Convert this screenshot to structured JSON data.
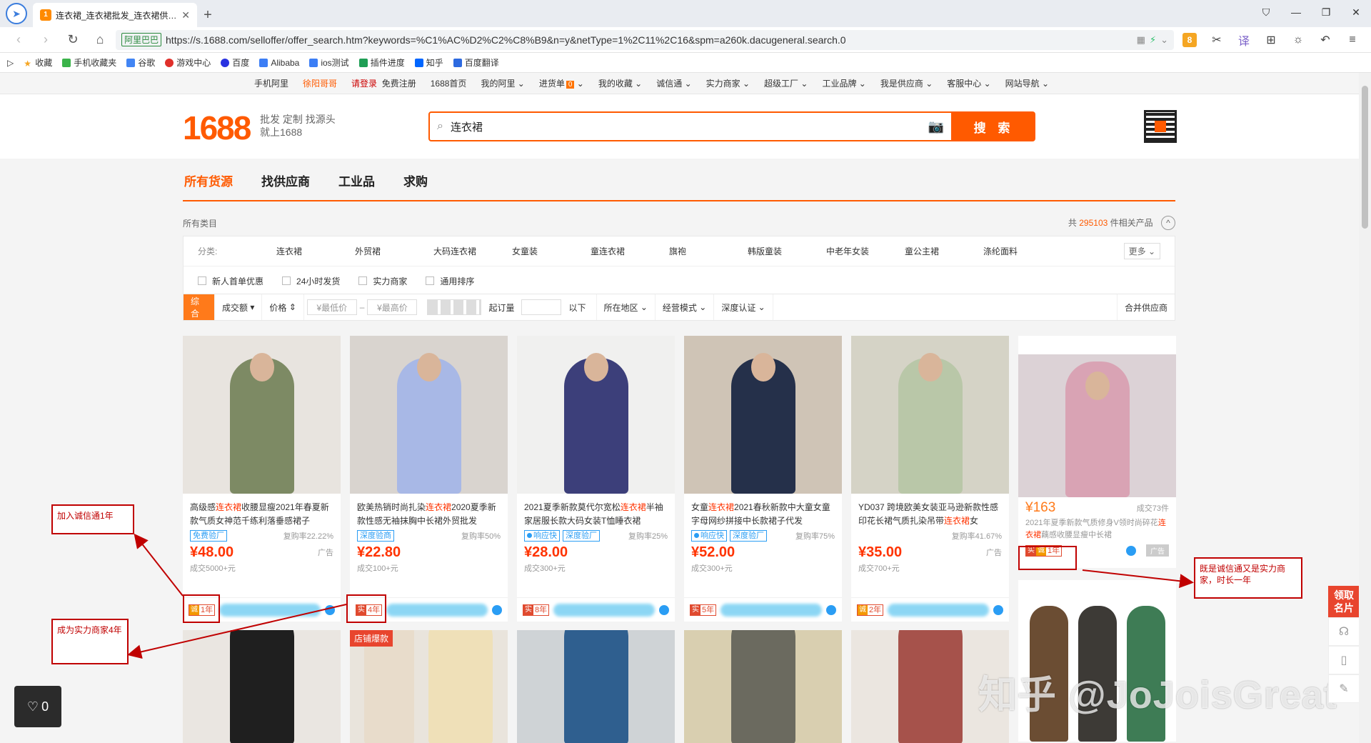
{
  "browser": {
    "tab_title": "连衣裙_连衣裙批发_连衣裙供应...",
    "url": "https://s.1688.com/selloffer/offer_search.htm?keywords=%C1%AC%D2%C2%C8%B9&n=y&netType=1%2C11%2C16&spm=a260k.dacugeneral.search.0",
    "site_label": "阿里巴巴",
    "bookmarks": [
      "收藏",
      "手机收藏夹",
      "谷歌",
      "游戏中心",
      "百度",
      "Alibaba",
      "ios测试",
      "插件进度",
      "知乎",
      "百度翻译"
    ]
  },
  "topnav": {
    "mobile": "手机阿里",
    "user": "徐阳哥哥",
    "login": "请登录",
    "register": "免费注册",
    "items": [
      "1688首页",
      "我的阿里",
      "进货单",
      "我的收藏",
      "诚信通",
      "实力商家",
      "超级工厂",
      "工业品牌",
      "我是供应商",
      "客服中心",
      "网站导航"
    ],
    "cart_count": "0"
  },
  "header": {
    "logo": "1688",
    "slogan_1": "批发 定制 找源头",
    "slogan_2": "就上1688",
    "search_value": "连衣裙",
    "search_button": "搜 索"
  },
  "main_tabs": [
    "所有货源",
    "找供应商",
    "工业品",
    "求购"
  ],
  "crumb": {
    "all_categories": "所有类目",
    "total_prefix": "共",
    "total_count": "295103",
    "total_suffix": "件相关产品"
  },
  "categories": {
    "label": "分类:",
    "items": [
      "连衣裙",
      "外贸裙",
      "大码连衣裙",
      "女童装",
      "童连衣裙",
      "旗袍",
      "韩版童装",
      "中老年女装",
      "童公主裙",
      "涤纶面料"
    ],
    "more": "更多"
  },
  "checkboxes": [
    "新人首单优惠",
    "24小时发货",
    "实力商家",
    "通用排序"
  ],
  "sortbar": {
    "items": [
      "综合",
      "成交额",
      "价格"
    ],
    "min_price": "¥最低价",
    "max_price": "¥最高价",
    "moq_label": "起订量",
    "below": "以下",
    "region": "所在地区",
    "mode": "经营模式",
    "cert": "深度认证",
    "merge": "合并供应商"
  },
  "products": [
    {
      "title_pre": "高级感",
      "kw": "连衣裙",
      "title_post": "收腰显瘦2021年春夏新款气质女神范千练利落垂感裙子",
      "tags": [
        "免费验厂"
      ],
      "rate": "复购率22.22%",
      "price": "¥48.00",
      "ad": "广告",
      "deal": "成交5000+元",
      "years": "1年",
      "img_bg": "#e8e4df",
      "fig": "#7d8a64"
    },
    {
      "title_pre": "欧美热销时尚扎染",
      "kw": "连衣裙",
      "title_post": "2020夏季新款性感无袖抹胸中长裙外贸批发",
      "tags": [
        "深度验商"
      ],
      "rate": "复购率50%",
      "price": "¥22.80",
      "ad": "",
      "deal": "成交100+元",
      "years": "4年",
      "img_bg": "#d9d4cf",
      "fig": "#a8b8e6"
    },
    {
      "title_pre": "2021夏季新款莫代尔宽松",
      "kw": "连衣裙",
      "title_post": "半袖家居服长款大码女装T恤睡衣裙",
      "tags": [
        "响应快",
        "深度验厂"
      ],
      "rate": "复购率25%",
      "price": "¥28.00",
      "ad": "",
      "deal": "成交300+元",
      "years": "8年",
      "img_bg": "#f0f0ef",
      "fig": "#3c3f7a"
    },
    {
      "title_pre": "女童",
      "kw": "连衣裙",
      "title_post": "2021春秋新款中大童女童字母网纱拼接中长款裙子代发",
      "tags": [
        "响应快",
        "深度验厂"
      ],
      "rate": "复购率75%",
      "price": "¥52.00",
      "ad": "",
      "deal": "成交300+元",
      "years": "5年",
      "img_bg": "#cfc4b6",
      "fig": "#25304a"
    },
    {
      "title_pre": "YD037 跨境欧美女装亚马逊新款性感印花长裙气质扎染吊带",
      "kw": "连衣裙",
      "title_post": "女",
      "tags": [],
      "rate": "复购率41.67%",
      "price": "¥35.00",
      "ad": "广告",
      "deal": "成交700+元",
      "years": "2年",
      "img_bg": "#d5d3c6",
      "fig": "#b9c7a8"
    }
  ],
  "alt_product": {
    "price": "¥163",
    "deal": "成交73件",
    "sub_pre": "2021年夏季新款气质修身V领时尚碎花",
    "kw": "连衣裙",
    "sub_post": "藕感收腰显瘦中长裙",
    "years": "1年",
    "ad": "广告"
  },
  "row2": {
    "hot_label": "店铺爆款"
  },
  "annotations": {
    "note_1": "加入诚信通1年",
    "note_2": "成为实力商家4年",
    "note_3": "既是诚信通又是实力商家，时长一年"
  },
  "float": {
    "card_btn": "领取名片",
    "like_count": "0",
    "watermark": "知乎 @JoJoisGreat"
  },
  "colors": {
    "brand": "#ff5a00",
    "annotation": "#c00000",
    "price": "#ff3300"
  }
}
